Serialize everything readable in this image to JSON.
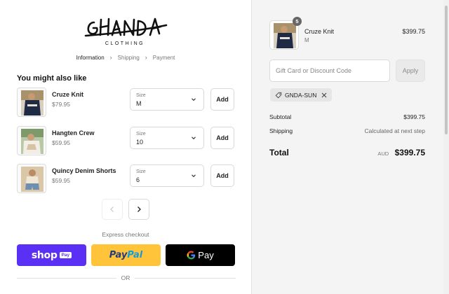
{
  "brand": {
    "logo_text": "GHANDA",
    "logo_subtext": "CLOTHING"
  },
  "breadcrumb": [
    "Information",
    "Shipping",
    "Payment"
  ],
  "upsell": {
    "title": "You might also like",
    "size_label": "Size",
    "add_label": "Add",
    "products": [
      {
        "name": "Cruze Knit",
        "price": "$79.95",
        "size": "M"
      },
      {
        "name": "Hangten Crew",
        "price": "$59.95",
        "size": "10"
      },
      {
        "name": "Quincy Denim Shorts",
        "price": "$59.95",
        "size": "6"
      }
    ]
  },
  "express": {
    "label": "Express checkout",
    "shop_text": "shop",
    "shop_badge": "Pay",
    "paypal_part1": "Pay",
    "paypal_part2": "Pal",
    "gpay_text": "Pay",
    "or_text": "OR"
  },
  "cart": {
    "item": {
      "name": "Cruze Knit",
      "variant": "M",
      "price": "$399.75",
      "quantity": "5"
    },
    "discount_placeholder": "Gift Card or Discount Code",
    "apply_label": "Apply",
    "applied_code": "GNDA-SUN",
    "subtotal_label": "Subtotal",
    "subtotal_value": "$399.75",
    "shipping_label": "Shipping",
    "shipping_value": "Calculated at next step",
    "total_label": "Total",
    "currency": "AUD",
    "total_value": "$399.75"
  },
  "colors": {
    "shop_pay": "#5a31f4",
    "paypal": "#ffc439",
    "gpay": "#000000",
    "summary_bg": "#f4f4f4"
  }
}
